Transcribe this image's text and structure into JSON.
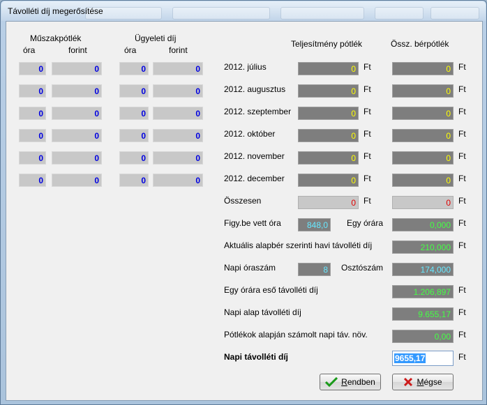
{
  "window": {
    "title": "Távolléti díj megerősítése"
  },
  "left": {
    "group1_title": "Műszakpótlék",
    "group2_title": "Ügyeleti díj",
    "col_ora": "óra",
    "col_forint": "forint",
    "rows": [
      {
        "m_ora": "0",
        "m_ft": "0",
        "u_ora": "0",
        "u_ft": "0"
      },
      {
        "m_ora": "0",
        "m_ft": "0",
        "u_ora": "0",
        "u_ft": "0"
      },
      {
        "m_ora": "0",
        "m_ft": "0",
        "u_ora": "0",
        "u_ft": "0"
      },
      {
        "m_ora": "0",
        "m_ft": "0",
        "u_ora": "0",
        "u_ft": "0"
      },
      {
        "m_ora": "0",
        "m_ft": "0",
        "u_ora": "0",
        "u_ft": "0"
      },
      {
        "m_ora": "0",
        "m_ft": "0",
        "u_ora": "0",
        "u_ft": "0"
      }
    ]
  },
  "right": {
    "col_teljesitmeny": "Teljesítmény pótlék",
    "col_ossz": "Össz. bérpótlék",
    "currency": "Ft",
    "months": [
      {
        "label": "2012. július",
        "telj": "0",
        "ossz": "0"
      },
      {
        "label": "2012. augusztus",
        "telj": "0",
        "ossz": "0"
      },
      {
        "label": "2012. szeptember",
        "telj": "0",
        "ossz": "0"
      },
      {
        "label": "2012. október",
        "telj": "0",
        "ossz": "0"
      },
      {
        "label": "2012. november",
        "telj": "0",
        "ossz": "0"
      },
      {
        "label": "2012. december",
        "telj": "0",
        "ossz": "0"
      }
    ],
    "total": {
      "label": "Összesen",
      "telj": "0",
      "ossz": "0"
    },
    "figyelembe": {
      "label": "Figy.be vett óra",
      "value": "848,0",
      "label2": "Egy órára",
      "value2": "0,000"
    },
    "alapber": {
      "label": "Aktuális alapbér szerinti havi távolléti díj",
      "value": "210,000"
    },
    "oraszam": {
      "label": "Napi óraszám",
      "value": "8",
      "label2": "Osztószám",
      "value2": "174,000"
    },
    "egy_orara": {
      "label": "Egy órára eső távolléti díj",
      "value": "1.206,897"
    },
    "napi_alap": {
      "label": "Napi alap távolléti díj",
      "value": "9.655,17"
    },
    "potlekok": {
      "label": "Pótlékok alapján számolt napi táv. növ.",
      "value": "0,00"
    },
    "napi_tavolleti": {
      "label": "Napi távolléti díj",
      "value": "9655,17"
    }
  },
  "buttons": {
    "ok_underlined": "R",
    "ok_rest": "endben",
    "cancel_underlined": "M",
    "cancel_rest": "égse"
  },
  "colors": {
    "check": "#1a9a1a",
    "cross": "#cc1a1a"
  }
}
